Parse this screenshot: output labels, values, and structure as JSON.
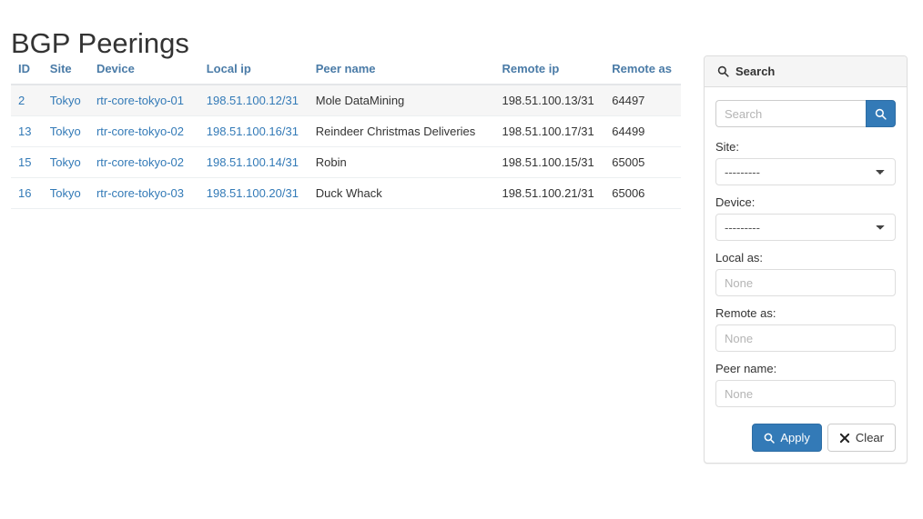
{
  "page": {
    "title": "BGP Peerings"
  },
  "table": {
    "columns": [
      {
        "key": "id",
        "label": "ID"
      },
      {
        "key": "site",
        "label": "Site"
      },
      {
        "key": "device",
        "label": "Device"
      },
      {
        "key": "local_ip",
        "label": "Local ip"
      },
      {
        "key": "peer_name",
        "label": "Peer name"
      },
      {
        "key": "remote_ip",
        "label": "Remote ip"
      },
      {
        "key": "remote_as",
        "label": "Remote as"
      }
    ],
    "rows": [
      {
        "id": "2",
        "site": "Tokyo",
        "device": "rtr-core-tokyo-01",
        "local_ip": "198.51.100.12/31",
        "peer_name": "Mole DataMining",
        "remote_ip": "198.51.100.13/31",
        "remote_as": "64497",
        "highlighted": true
      },
      {
        "id": "13",
        "site": "Tokyo",
        "device": "rtr-core-tokyo-02",
        "local_ip": "198.51.100.16/31",
        "peer_name": "Reindeer Christmas Deliveries",
        "remote_ip": "198.51.100.17/31",
        "remote_as": "64499",
        "highlighted": false
      },
      {
        "id": "15",
        "site": "Tokyo",
        "device": "rtr-core-tokyo-02",
        "local_ip": "198.51.100.14/31",
        "peer_name": "Robin",
        "remote_ip": "198.51.100.15/31",
        "remote_as": "65005",
        "highlighted": false
      },
      {
        "id": "16",
        "site": "Tokyo",
        "device": "rtr-core-tokyo-03",
        "local_ip": "198.51.100.20/31",
        "peer_name": "Duck Whack",
        "remote_ip": "198.51.100.21/31",
        "remote_as": "65006",
        "highlighted": false
      }
    ]
  },
  "search_panel": {
    "heading": "Search",
    "heading_icon": "search-icon",
    "quick_search": {
      "value": "",
      "placeholder": "Search",
      "button_icon": "search-icon"
    },
    "fields": [
      {
        "name": "site",
        "label": "Site:",
        "type": "select",
        "selected": "---------",
        "options": [
          "---------"
        ]
      },
      {
        "name": "device",
        "label": "Device:",
        "type": "select",
        "selected": "---------",
        "options": [
          "---------"
        ]
      },
      {
        "name": "local_as",
        "label": "Local as:",
        "type": "text",
        "value": "",
        "placeholder": "None"
      },
      {
        "name": "remote_as",
        "label": "Remote as:",
        "type": "text",
        "value": "",
        "placeholder": "None"
      },
      {
        "name": "peer_name",
        "label": "Peer name:",
        "type": "text",
        "value": "",
        "placeholder": "None"
      }
    ],
    "actions": {
      "apply_label": "Apply",
      "apply_icon": "search-icon",
      "clear_label": "Clear",
      "clear_icon": "close-x-icon"
    }
  },
  "colors": {
    "link": "#337ab7",
    "header_text": "#4a7ba7",
    "primary": "#337ab7",
    "primary_border": "#2e6da4",
    "panel_border": "#dddddd",
    "panel_heading_bg": "#f5f5f5",
    "row_highlight_bg": "#f6f6f6",
    "text": "#333333",
    "placeholder": "#b4b4b4"
  }
}
